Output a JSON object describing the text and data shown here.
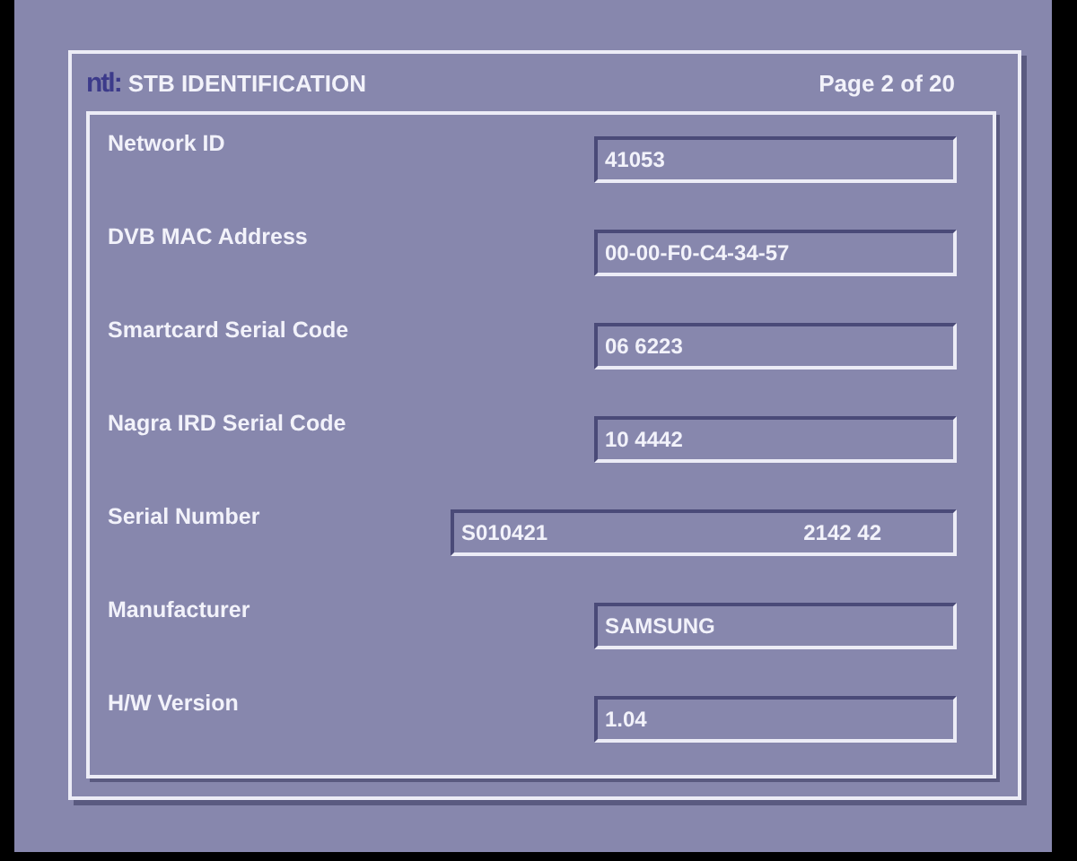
{
  "header": {
    "logo": "ntl:",
    "title": "STB IDENTIFICATION",
    "page": "Page 2 of 20"
  },
  "rows": [
    {
      "label": "Network ID",
      "kind": "normal",
      "values": [
        "41053"
      ]
    },
    {
      "label": "DVB MAC Address",
      "kind": "normal",
      "values": [
        "00-00-F0-C4-34-57"
      ]
    },
    {
      "label": "Smartcard Serial Code",
      "kind": "normal",
      "values": [
        "06 6223"
      ]
    },
    {
      "label": "Nagra IRD Serial Code",
      "kind": "normal",
      "values": [
        "10 4442"
      ]
    },
    {
      "label": "Serial Number",
      "kind": "wide",
      "values": [
        "S010421",
        "2142 42"
      ]
    },
    {
      "label": "Manufacturer",
      "kind": "normal",
      "values": [
        "SAMSUNG"
      ]
    },
    {
      "label": "H/W Version",
      "kind": "normal",
      "values": [
        "1.04"
      ]
    }
  ]
}
